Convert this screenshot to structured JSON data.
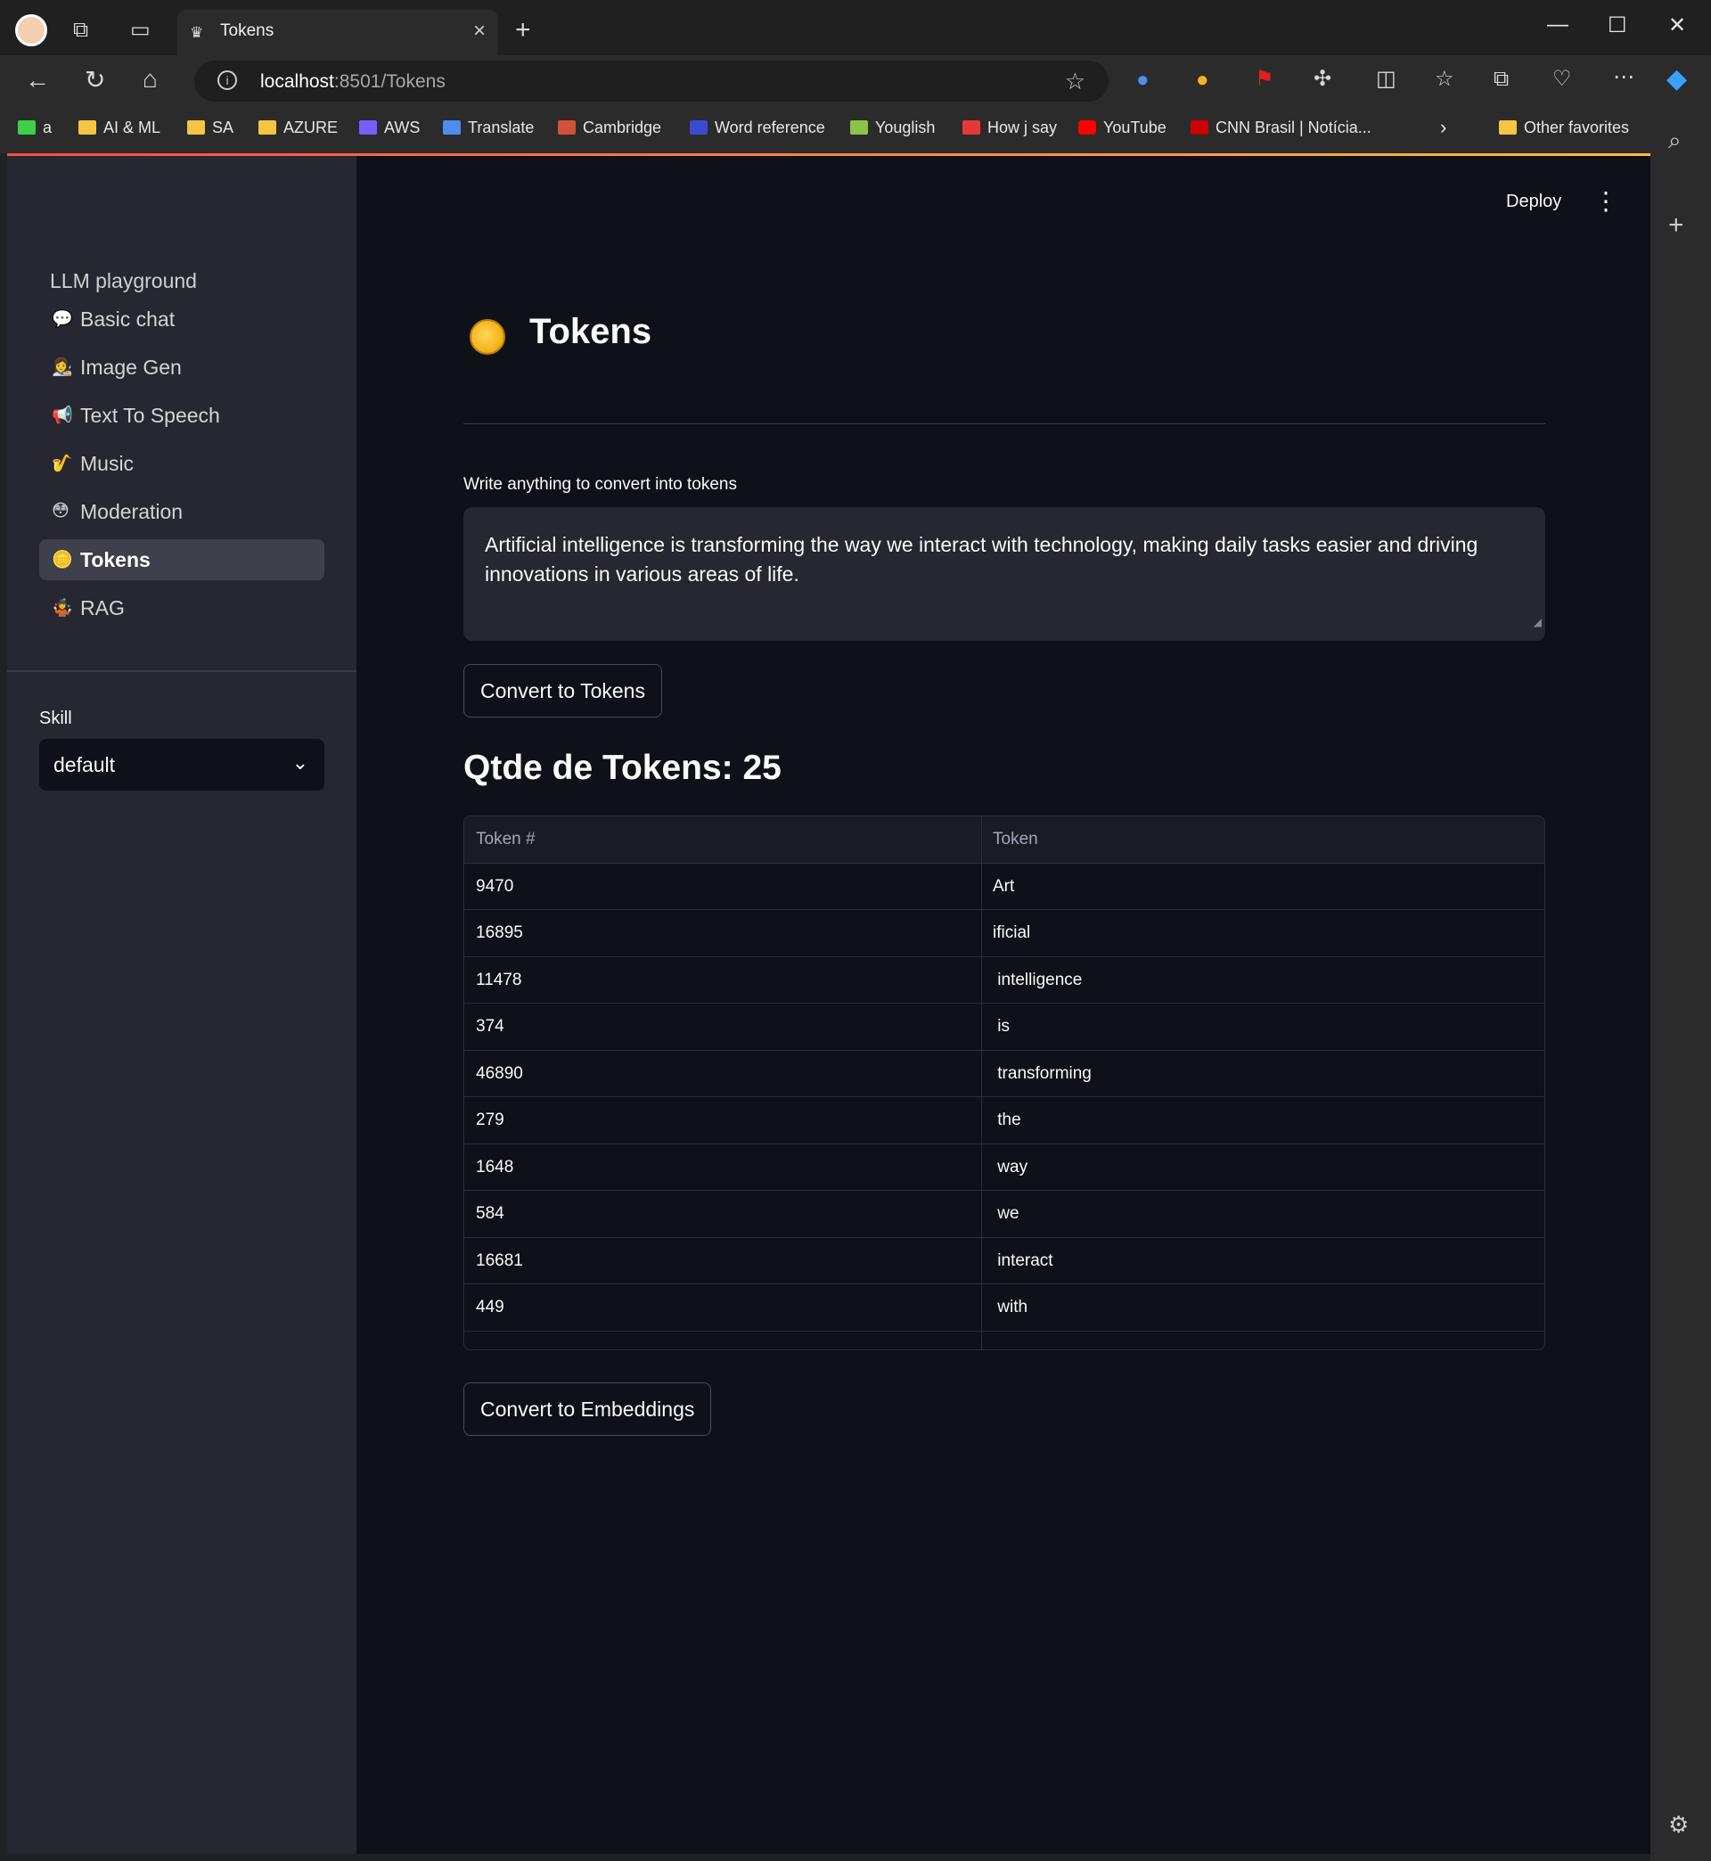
{
  "browser": {
    "tab_title": "Tokens",
    "url_host": "localhost",
    "url_rest": ":8501/Tokens",
    "bookmarks": [
      {
        "label": "a",
        "icon": "green-icon"
      },
      {
        "label": "AI & ML",
        "icon": "folder-icon"
      },
      {
        "label": "SA",
        "icon": "folder-icon"
      },
      {
        "label": "AZURE",
        "icon": "folder-icon"
      },
      {
        "label": "AWS",
        "icon": "aws-icon"
      },
      {
        "label": "Translate",
        "icon": "translate-icon"
      },
      {
        "label": "Cambridge",
        "icon": "cambridge-icon"
      },
      {
        "label": "Word reference",
        "icon": "wordreference-icon"
      },
      {
        "label": "Youglish",
        "icon": "youglish-icon"
      },
      {
        "label": "How j say",
        "icon": "howjsay-icon"
      },
      {
        "label": "YouTube",
        "icon": "youtube-icon"
      },
      {
        "label": "CNN Brasil | Notícia...",
        "icon": "cnn-icon"
      }
    ],
    "other_favorites": "Other favorites"
  },
  "app": {
    "deploy_label": "Deploy",
    "sidebar": {
      "header": "LLM playground",
      "items": [
        {
          "label": "Basic chat",
          "emoji": "💬"
        },
        {
          "label": "Image Gen",
          "emoji": "👩‍🎨"
        },
        {
          "label": "Text To Speech",
          "emoji": "📢"
        },
        {
          "label": "Music",
          "emoji": "🎷"
        },
        {
          "label": "Moderation",
          "emoji": "😳"
        },
        {
          "label": "Tokens",
          "emoji": "🪙"
        },
        {
          "label": "RAG",
          "emoji": "🤹"
        }
      ],
      "active_item": "Tokens",
      "skill_label": "Skill",
      "skill_value": "default"
    },
    "main": {
      "title": "Tokens",
      "textarea_label": "Write anything to convert into tokens",
      "textarea_value": "Artificial intelligence is transforming the way we interact with technology, making daily tasks easier and driving innovations in various areas of life.",
      "convert_tokens_button": "Convert to Tokens",
      "count_heading": "Qtde de Tokens: 25",
      "table": {
        "columns": [
          "Token #",
          "Token"
        ],
        "rows": [
          [
            "9470",
            "Art"
          ],
          [
            "16895",
            "ificial"
          ],
          [
            "11478",
            " intelligence"
          ],
          [
            "374",
            " is"
          ],
          [
            "46890",
            " transforming"
          ],
          [
            "279",
            " the"
          ],
          [
            "1648",
            " way"
          ],
          [
            "584",
            " we"
          ],
          [
            "16681",
            " interact"
          ],
          [
            "449",
            " with"
          ]
        ]
      },
      "convert_embeddings_button": "Convert to Embeddings"
    }
  }
}
